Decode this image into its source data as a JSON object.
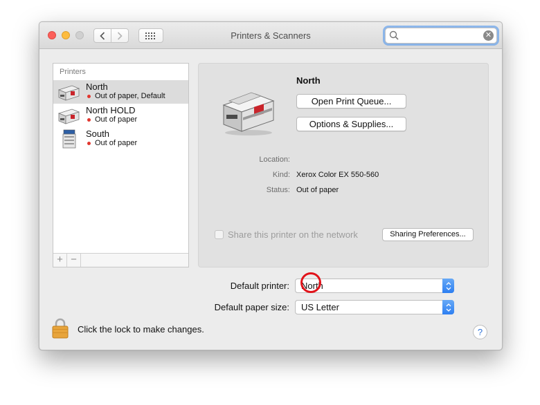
{
  "window": {
    "title": "Printers & Scanners"
  },
  "printers_header": "Printers",
  "printers": [
    {
      "name": "North",
      "status": "Out of paper, Default"
    },
    {
      "name": "North HOLD",
      "status": "Out of paper"
    },
    {
      "name": "South",
      "status": "Out of paper"
    }
  ],
  "list_footer": {
    "add": "+",
    "remove": "−"
  },
  "detail": {
    "name": "North",
    "open_queue_label": "Open Print Queue...",
    "options_label": "Options & Supplies...",
    "location_key": "Location:",
    "location_value": "",
    "kind_key": "Kind:",
    "kind_value": "Xerox Color EX 550-560",
    "status_key": "Status:",
    "status_value": "Out of paper",
    "share_label": "Share this printer on the network",
    "share_checked": false,
    "sharing_prefs_label": "Sharing Preferences..."
  },
  "default_printer": {
    "label": "Default printer:",
    "value": "North"
  },
  "default_paper": {
    "label": "Default paper size:",
    "value": "US Letter"
  },
  "lock_text": "Click the lock to make changes.",
  "help_label": "?",
  "colors": {
    "status_dot": "#e2372f",
    "accent": "#2d7ff2",
    "highlight_ring": "#e1131a"
  }
}
